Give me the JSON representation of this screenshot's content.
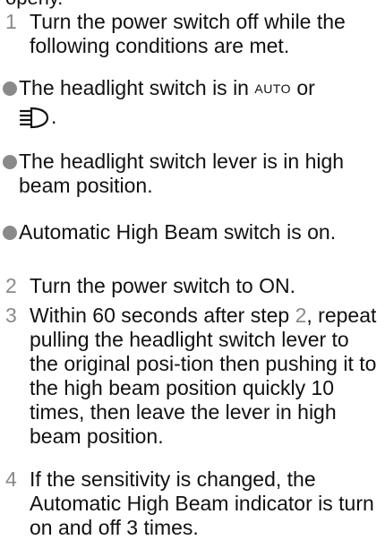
{
  "top_fragment": "operly.",
  "steps": [
    {
      "num": "1",
      "text": "Turn the power switch off while the following conditions are met."
    },
    {
      "num": "2",
      "text": "Turn the power switch to ON."
    },
    {
      "num": "3",
      "text_before": "Within 60 seconds after step ",
      "ref": "2",
      "text_after": ", repeat pulling the headlight switch lever to the original posi-tion then pushing it to the high beam position quickly 10 times, then leave the lever in high beam position."
    },
    {
      "num": "4",
      "text": "If the sensitivity is changed, the Automatic High Beam indicator is turn on and off 3 times."
    }
  ],
  "bullets": [
    {
      "text_before": "The headlight switch is in ",
      "auto_label": "AUTO",
      "text_after": " or",
      "icon_name": "headlight-low-beam-icon",
      "line2_suffix": "."
    },
    {
      "text": "The headlight switch lever is in high beam position."
    },
    {
      "text": "Automatic High Beam switch is on."
    }
  ]
}
